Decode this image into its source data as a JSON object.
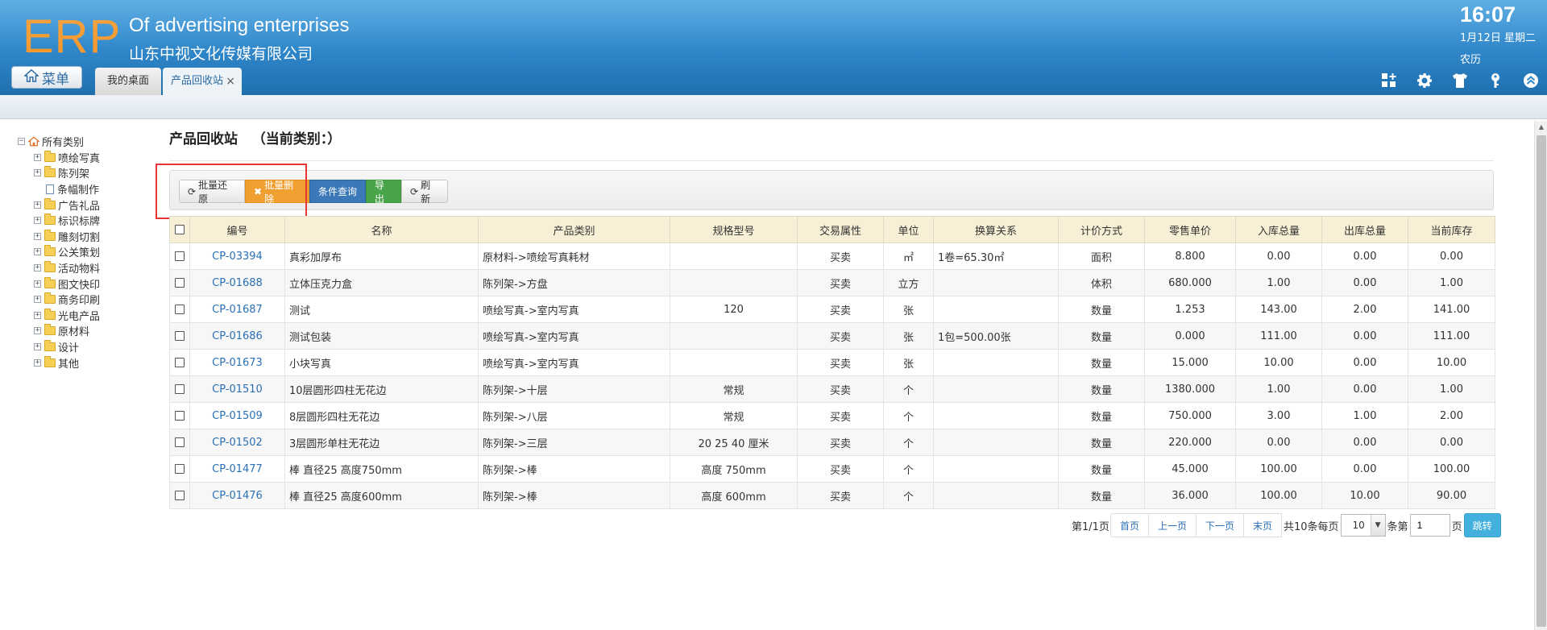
{
  "header": {
    "logo": "ERP",
    "company_en": "Of advertising enterprises",
    "company_cn": "山东中视文化传媒有限公司",
    "time": "16:07",
    "date": "1月12日 星期二",
    "lunar": "农历",
    "menu_label": "菜单",
    "tabs": [
      {
        "label": "我的桌面"
      },
      {
        "label": "产品回收站",
        "close": "×"
      }
    ],
    "icons": [
      "grid-plus-icon",
      "gear-icon",
      "shirt-icon",
      "key-icon",
      "collapse-up-icon"
    ]
  },
  "sidebar": {
    "root": "所有类别",
    "items": [
      {
        "label": "喷绘写真",
        "type": "folder"
      },
      {
        "label": "陈列架",
        "type": "folder"
      },
      {
        "label": "条幅制作",
        "type": "file"
      },
      {
        "label": "广告礼品",
        "type": "folder"
      },
      {
        "label": "标识标牌",
        "type": "folder"
      },
      {
        "label": "雕刻切割",
        "type": "folder"
      },
      {
        "label": "公关策划",
        "type": "folder"
      },
      {
        "label": "活动物料",
        "type": "folder"
      },
      {
        "label": "图文快印",
        "type": "folder"
      },
      {
        "label": "商务印刷",
        "type": "folder"
      },
      {
        "label": "光电产品",
        "type": "folder"
      },
      {
        "label": "原材料",
        "type": "folder"
      },
      {
        "label": "设计",
        "type": "folder"
      },
      {
        "label": "其他",
        "type": "folder"
      }
    ]
  },
  "main": {
    "title": "产品回收站",
    "category_label": "（当前类别：）",
    "toolbar": {
      "restore": "批量还原",
      "delete": "批量删除",
      "query": "条件查询",
      "export": "导出",
      "refresh": "刷新"
    },
    "table": {
      "headers": [
        "编号",
        "名称",
        "产品类别",
        "规格型号",
        "交易属性",
        "单位",
        "换算关系",
        "计价方式",
        "零售单价",
        "入库总量",
        "出库总量",
        "当前库存"
      ],
      "rows": [
        [
          "CP-03394",
          "真彩加厚布",
          "原材料->喷绘写真耗材",
          "",
          "买卖",
          "㎡",
          "1卷=65.30㎡",
          "面积",
          "8.800",
          "0.00",
          "0.00",
          "0.00"
        ],
        [
          "CP-01688",
          "立体压克力盒",
          "陈列架->方盘",
          "",
          "买卖",
          "立方",
          "",
          "体积",
          "680.000",
          "1.00",
          "0.00",
          "1.00"
        ],
        [
          "CP-01687",
          "测试",
          "喷绘写真->室内写真",
          "120",
          "买卖",
          "张",
          "",
          "数量",
          "1.253",
          "143.00",
          "2.00",
          "141.00"
        ],
        [
          "CP-01686",
          "测试包装",
          "喷绘写真->室内写真",
          "",
          "买卖",
          "张",
          "1包=500.00张",
          "数量",
          "0.000",
          "111.00",
          "0.00",
          "111.00"
        ],
        [
          "CP-01673",
          "小块写真",
          "喷绘写真->室内写真",
          "",
          "买卖",
          "张",
          "",
          "数量",
          "15.000",
          "10.00",
          "0.00",
          "10.00"
        ],
        [
          "CP-01510",
          "10层圆形四柱无花边",
          "陈列架->十层",
          "常规",
          "买卖",
          "个",
          "",
          "数量",
          "1380.000",
          "1.00",
          "0.00",
          "1.00"
        ],
        [
          "CP-01509",
          "8层圆形四柱无花边",
          "陈列架->八层",
          "常规",
          "买卖",
          "个",
          "",
          "数量",
          "750.000",
          "3.00",
          "1.00",
          "2.00"
        ],
        [
          "CP-01502",
          "3层圆形单柱无花边",
          "陈列架->三层",
          "20 25 40 厘米",
          "买卖",
          "个",
          "",
          "数量",
          "220.000",
          "0.00",
          "0.00",
          "0.00"
        ],
        [
          "CP-01477",
          "棒 直径25 高度750mm",
          "陈列架->棒",
          "高度 750mm",
          "买卖",
          "个",
          "",
          "数量",
          "45.000",
          "100.00",
          "0.00",
          "100.00"
        ],
        [
          "CP-01476",
          "棒 直径25 高度600mm",
          "陈列架->棒",
          "高度 600mm",
          "买卖",
          "个",
          "",
          "数量",
          "36.000",
          "100.00",
          "10.00",
          "90.00"
        ]
      ]
    },
    "pager": {
      "page_info": "第1/1页",
      "first": "首页",
      "prev": "上一页",
      "next": "下一页",
      "last": "末页",
      "total": "共10条每页",
      "page_size": "10",
      "per_suffix": "条第",
      "page_value": "1",
      "page_suffix": "页",
      "go": "跳转"
    }
  }
}
